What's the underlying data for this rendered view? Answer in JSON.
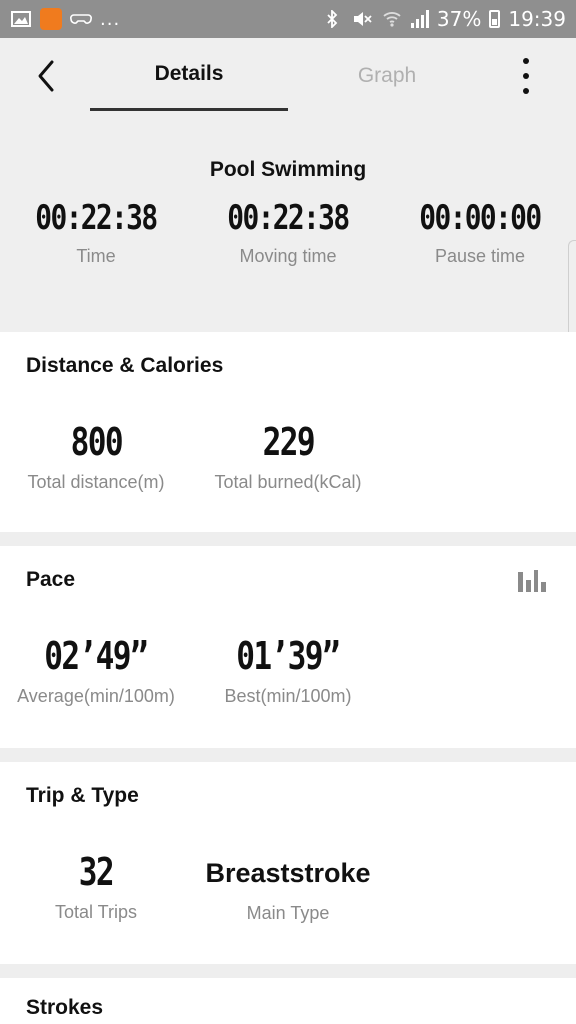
{
  "status_bar": {
    "left_icons": [
      "image-icon",
      "app-icon",
      "game-controller-icon"
    ],
    "more": "...",
    "right_icons": [
      "bluetooth-icon",
      "mute-icon",
      "wifi-icon",
      "signal-icon"
    ],
    "battery_percent": "37%",
    "time": "19:39"
  },
  "header": {
    "tabs": [
      {
        "label": "Details",
        "active": true
      },
      {
        "label": "Graph",
        "active": false
      }
    ]
  },
  "summary": {
    "title": "Pool Swimming",
    "stats": [
      {
        "value": "00:22:38",
        "label": "Time"
      },
      {
        "value": "00:22:38",
        "label": "Moving time"
      },
      {
        "value": "00:00:00",
        "label": "Pause time"
      }
    ]
  },
  "distance_calories": {
    "title": "Distance & Calories",
    "stats": [
      {
        "value": "800",
        "label": "Total distance(m)"
      },
      {
        "value": "229",
        "label": "Total burned(kCal)"
      }
    ]
  },
  "pace": {
    "title": "Pace",
    "stats": [
      {
        "value": "02’49”",
        "label": "Average(min/100m)"
      },
      {
        "value": "01’39”",
        "label": "Best(min/100m)"
      }
    ]
  },
  "trip_type": {
    "title": "Trip & Type",
    "stats": [
      {
        "value": "32",
        "label": "Total Trips"
      },
      {
        "value": "Breaststroke",
        "label": "Main Type"
      }
    ]
  },
  "strokes": {
    "title": "Strokes"
  },
  "colors": {
    "background": "#eeeeee",
    "card": "#ffffff",
    "status_bar": "#8f8f8f",
    "inactive_tab": "#b0b0b0",
    "label": "#8a8a8a",
    "app_icon": "#f07b1e"
  }
}
